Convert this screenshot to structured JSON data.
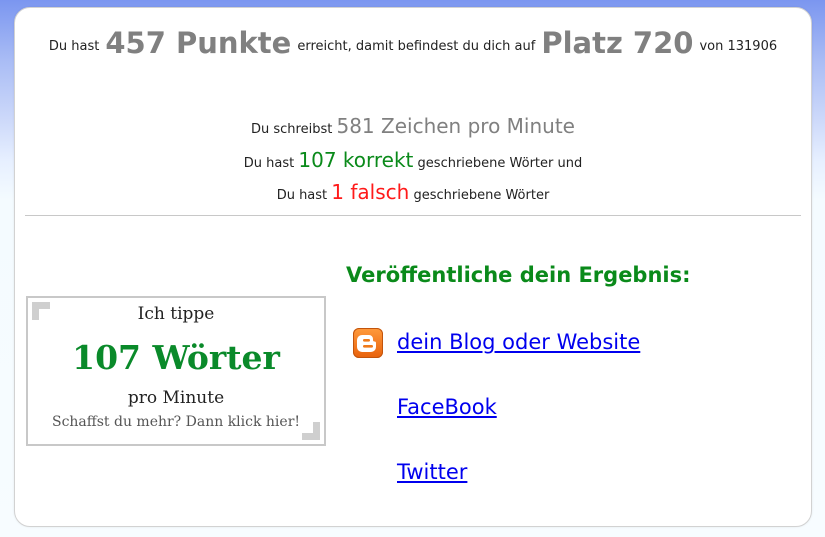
{
  "summary": {
    "prefix": "Du hast",
    "points": "457 Punkte",
    "middle": "erreicht, damit befindest du dich auf",
    "rank": "Platz 720",
    "suffix": "von 131906"
  },
  "stats": {
    "speed_prefix": "Du schreibst",
    "speed_value": "581 Zeichen pro Minute",
    "correct_prefix": "Du hast",
    "correct_value": "107 korrekt",
    "correct_suffix": "geschriebene Wörter und",
    "wrong_prefix": "Du hast",
    "wrong_value": "1 falsch",
    "wrong_suffix": "geschriebene Wörter"
  },
  "badge": {
    "line1": "Ich tippe",
    "words": "107 Wörter",
    "line3": "pro Minute",
    "line4": "Schaffst du mehr? Dann klick hier!"
  },
  "publish": {
    "heading": "Veröffentliche dein Ergebnis:",
    "links": [
      {
        "label": "dein Blog oder Website",
        "icon": "blogger-icon"
      },
      {
        "label": "FaceBook"
      },
      {
        "label": "Twitter"
      }
    ]
  },
  "colors": {
    "green": "#0a8a1a",
    "red": "#ff1a1a",
    "grey": "#808080",
    "link": "#0000ee"
  }
}
